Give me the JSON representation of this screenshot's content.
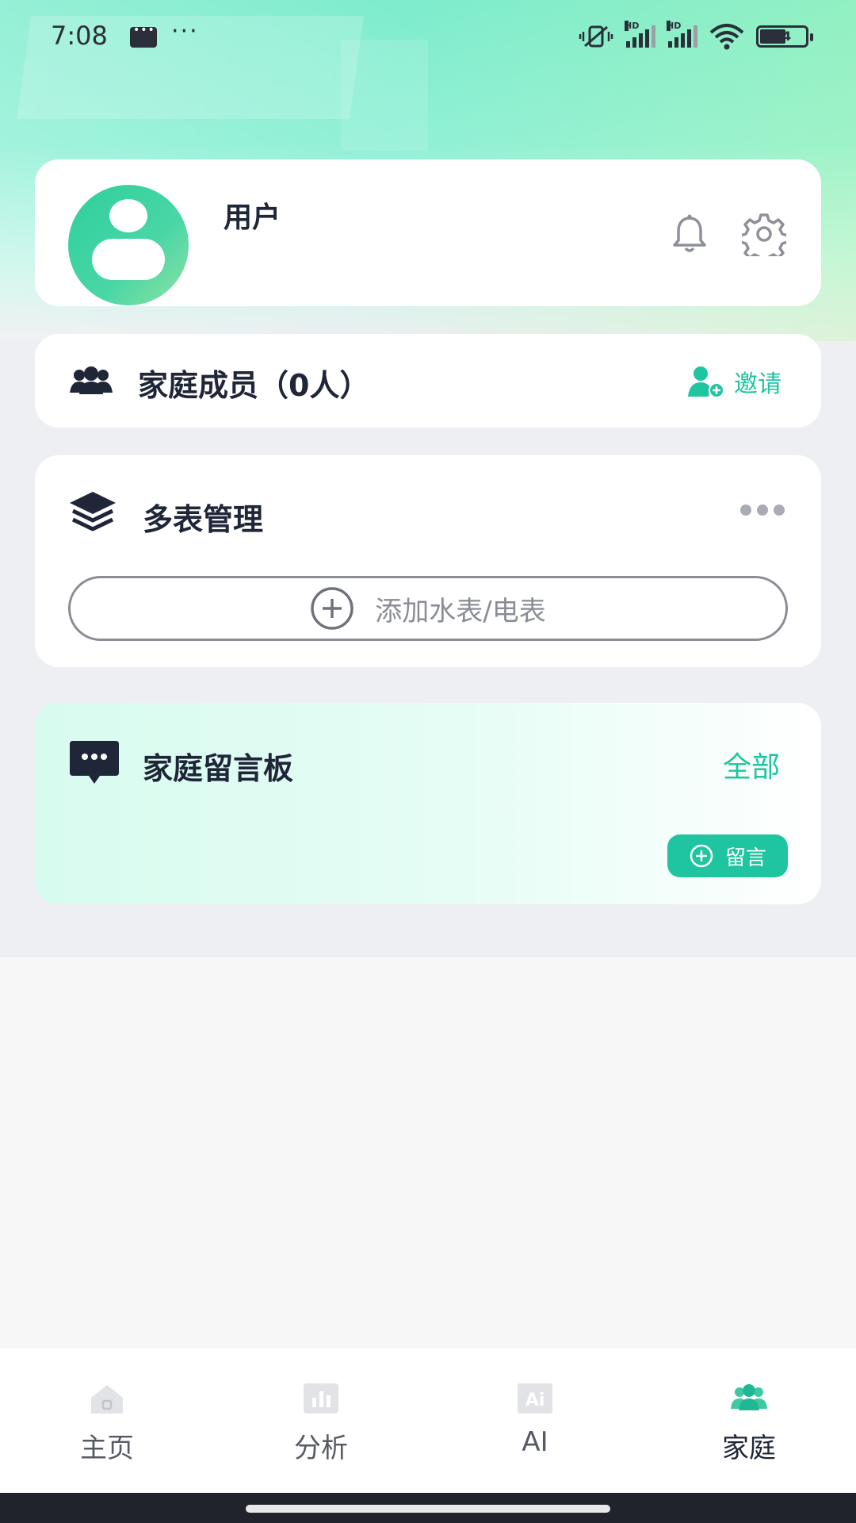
{
  "status_bar": {
    "time": "7:08",
    "signal_label": "HD",
    "battery": "54"
  },
  "profile": {
    "username": "用户"
  },
  "members": {
    "title": "家庭成员（0人）",
    "invite_label": "邀请"
  },
  "multi_meter": {
    "title": "多表管理",
    "add_label": "添加水表/电表"
  },
  "message_board": {
    "title": "家庭留言板",
    "all_label": "全部",
    "leave_message_label": "留言"
  },
  "tabbar": {
    "tabs": [
      {
        "label": "主页",
        "icon": "home-icon",
        "active": false
      },
      {
        "label": "分析",
        "icon": "chart-icon",
        "active": false
      },
      {
        "label": "AI",
        "icon": "ai-icon",
        "active": false
      },
      {
        "label": "家庭",
        "icon": "family-icon",
        "active": true
      }
    ]
  },
  "colors": {
    "accent": "#1fc4a0",
    "header_gradient_start": "#7eeccd",
    "dark_text": "#1f2638"
  }
}
